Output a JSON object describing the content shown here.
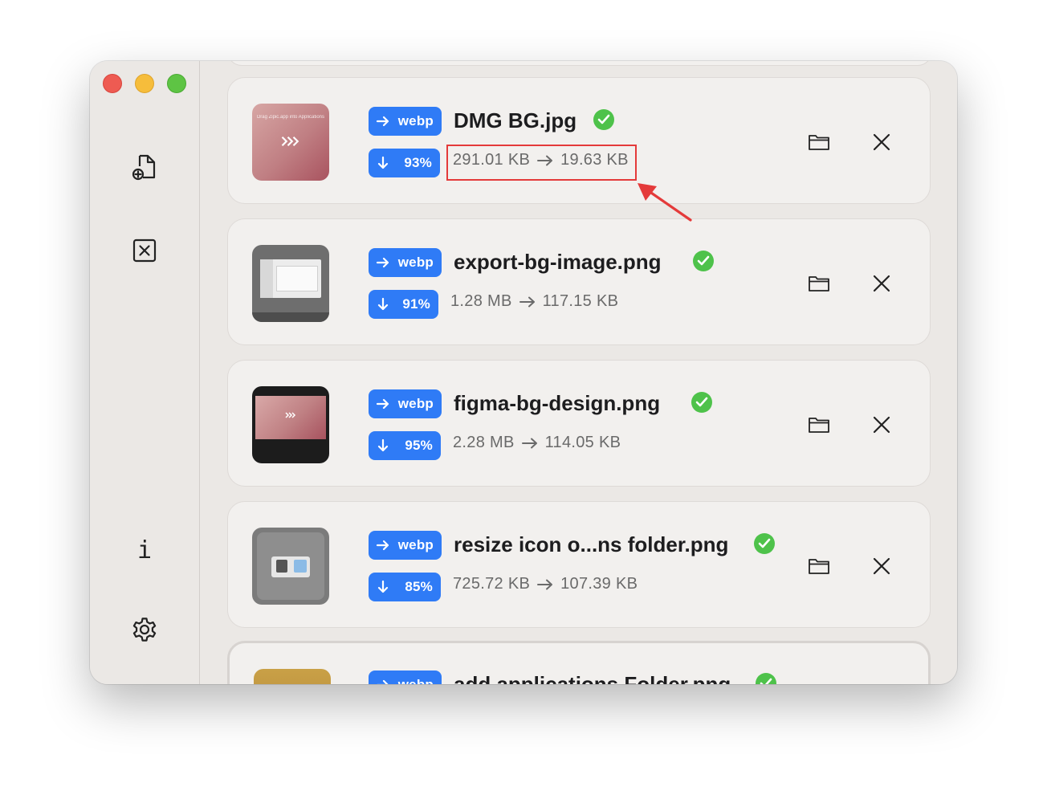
{
  "sidebar": {
    "traffic_lights": [
      "close",
      "minimize",
      "zoom"
    ],
    "buttons": [
      {
        "name": "add-file",
        "icon": "file-plus-icon"
      },
      {
        "name": "clear",
        "icon": "x-square-icon"
      },
      {
        "name": "info",
        "icon": "info-icon",
        "glyph": "i"
      },
      {
        "name": "settings",
        "icon": "gear-icon"
      }
    ]
  },
  "files": [
    {
      "name": "DMG BG.jpg",
      "format": "webp",
      "reduction": "93%",
      "original_size": "291.01 KB",
      "new_size": "19.63 KB",
      "thumb": "pink-gradient",
      "thumb_text": "Drag Zipic.app into Applications"
    },
    {
      "name": "export-bg-image.png",
      "format": "webp",
      "reduction": "91%",
      "original_size": "1.28 MB",
      "new_size": "117.15 KB",
      "thumb": "gray-window"
    },
    {
      "name": "figma-bg-design.png",
      "format": "webp",
      "reduction": "95%",
      "original_size": "2.28 MB",
      "new_size": "114.05 KB",
      "thumb": "dark-window"
    },
    {
      "name": "resize icon o...ns folder.png",
      "format": "webp",
      "reduction": "85%",
      "original_size": "725.72 KB",
      "new_size": "107.39 KB",
      "thumb": "gray-icons"
    },
    {
      "name": "add applications Folder.png",
      "format": "webp",
      "reduction": "",
      "original_size": "",
      "new_size": "",
      "thumb": "gold"
    }
  ],
  "colors": {
    "accent": "#2f7bf6",
    "success": "#4ec24a",
    "annotation": "#e43a3a"
  }
}
